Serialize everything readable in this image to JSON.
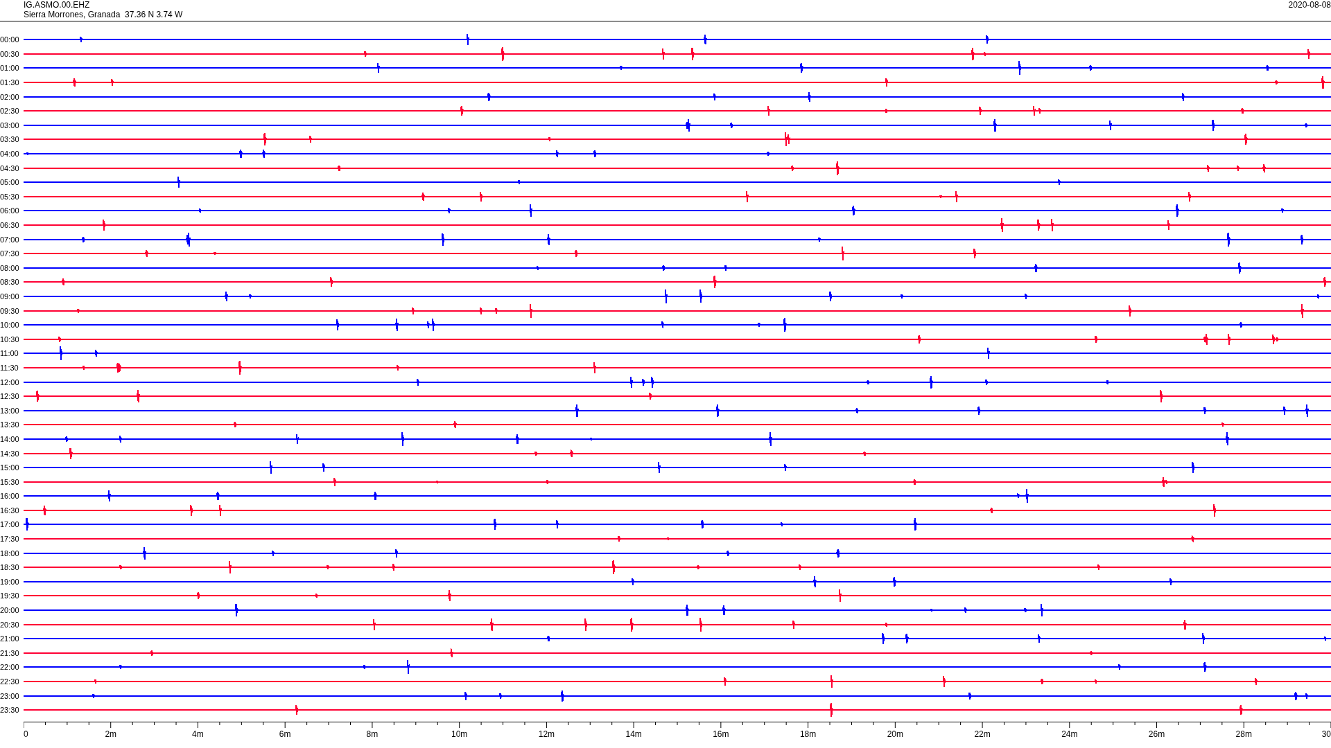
{
  "header": {
    "station": "IG.ASMO.00.EHZ",
    "location": "Sierra Morrones, Granada  37.36 N 3.74 W",
    "date": "2020-08-08"
  },
  "traces": [
    {
      "time": "00:00",
      "color": "#0000ff"
    },
    {
      "time": "00:30",
      "color": "#ff0033"
    },
    {
      "time": "01:00",
      "color": "#0000ff"
    },
    {
      "time": "01:30",
      "color": "#ff0033"
    },
    {
      "time": "02:00",
      "color": "#0000ff"
    },
    {
      "time": "02:30",
      "color": "#ff0033"
    },
    {
      "time": "03:00",
      "color": "#0000ff"
    },
    {
      "time": "03:30",
      "color": "#ff0033"
    },
    {
      "time": "04:00",
      "color": "#0000ff"
    },
    {
      "time": "04:30",
      "color": "#ff0033"
    },
    {
      "time": "05:00",
      "color": "#0000ff"
    },
    {
      "time": "05:30",
      "color": "#ff0033"
    },
    {
      "time": "06:00",
      "color": "#0000ff"
    },
    {
      "time": "06:30",
      "color": "#ff0033"
    },
    {
      "time": "07:00",
      "color": "#0000ff"
    },
    {
      "time": "07:30",
      "color": "#ff0033"
    },
    {
      "time": "08:00",
      "color": "#0000ff"
    },
    {
      "time": "08:30",
      "color": "#ff0033"
    },
    {
      "time": "09:00",
      "color": "#0000ff"
    },
    {
      "time": "09:30",
      "color": "#ff0033"
    },
    {
      "time": "10:00",
      "color": "#0000ff"
    },
    {
      "time": "10:30",
      "color": "#ff0033"
    },
    {
      "time": "11:00",
      "color": "#0000ff"
    },
    {
      "time": "11:30",
      "color": "#ff0033"
    },
    {
      "time": "12:00",
      "color": "#0000ff"
    },
    {
      "time": "12:30",
      "color": "#ff0033"
    },
    {
      "time": "13:00",
      "color": "#0000ff"
    },
    {
      "time": "13:30",
      "color": "#ff0033"
    },
    {
      "time": "14:00",
      "color": "#0000ff"
    },
    {
      "time": "14:30",
      "color": "#ff0033"
    },
    {
      "time": "15:00",
      "color": "#0000ff"
    },
    {
      "time": "15:30",
      "color": "#ff0033"
    },
    {
      "time": "16:00",
      "color": "#0000ff"
    },
    {
      "time": "16:30",
      "color": "#ff0033"
    },
    {
      "time": "17:00",
      "color": "#0000ff"
    },
    {
      "time": "17:30",
      "color": "#ff0033"
    },
    {
      "time": "18:00",
      "color": "#0000ff"
    },
    {
      "time": "18:30",
      "color": "#ff0033"
    },
    {
      "time": "19:00",
      "color": "#0000ff"
    },
    {
      "time": "19:30",
      "color": "#ff0033"
    },
    {
      "time": "20:00",
      "color": "#0000ff"
    },
    {
      "time": "20:30",
      "color": "#ff0033"
    },
    {
      "time": "21:00",
      "color": "#0000ff"
    },
    {
      "time": "21:30",
      "color": "#ff0033"
    },
    {
      "time": "22:00",
      "color": "#0000ff"
    },
    {
      "time": "22:30",
      "color": "#ff0033"
    },
    {
      "time": "23:00",
      "color": "#0000ff"
    },
    {
      "time": "23:30",
      "color": "#ff0033"
    }
  ],
  "axis": {
    "ticks": [
      "0",
      "2m",
      "4m",
      "6m",
      "8m",
      "10m",
      "12m",
      "14m",
      "16m",
      "18m",
      "20m",
      "22m",
      "24m",
      "26m",
      "28m",
      "30"
    ]
  }
}
